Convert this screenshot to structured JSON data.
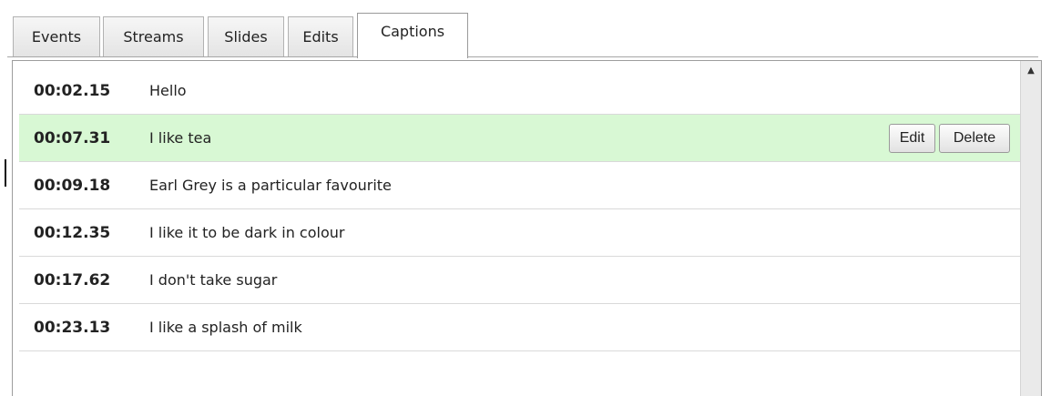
{
  "tabs": [
    {
      "label": "Events",
      "active": false
    },
    {
      "label": "Streams",
      "active": false
    },
    {
      "label": "Slides",
      "active": false
    },
    {
      "label": "Edits",
      "active": false
    },
    {
      "label": "Captions",
      "active": true
    }
  ],
  "captions": [
    {
      "time": "00:02.15",
      "text": "Hello"
    },
    {
      "time": "00:07.31",
      "text": "I like tea",
      "selected": true
    },
    {
      "time": "00:09.18",
      "text": "Earl Grey is a particular favourite"
    },
    {
      "time": "00:12.35",
      "text": "I like it to be dark in colour"
    },
    {
      "time": "00:17.62",
      "text": "I don't take sugar"
    },
    {
      "time": "00:23.13",
      "text": "I like a splash of milk"
    }
  ],
  "row_actions": {
    "edit_label": "Edit",
    "delete_label": "Delete"
  },
  "colors": {
    "selected_row": "#d8f8d4"
  },
  "icons": {
    "scroll_up": "triangle-up"
  }
}
